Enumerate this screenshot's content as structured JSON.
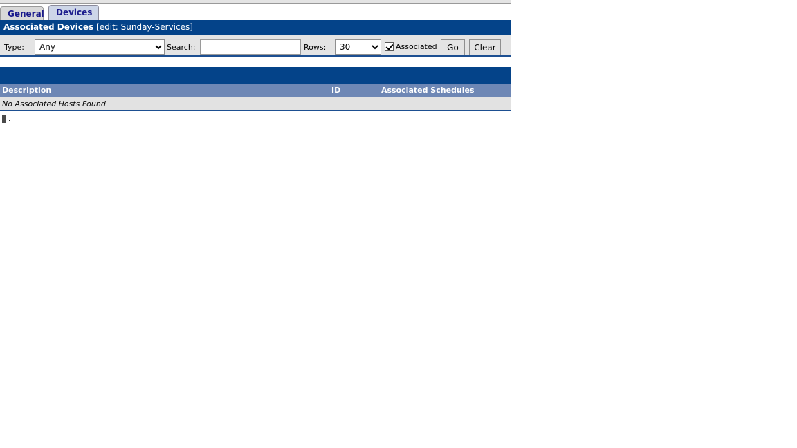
{
  "tabs": [
    {
      "label": "General",
      "active": false
    },
    {
      "label": "Devices",
      "active": true
    }
  ],
  "section": {
    "title": "Associated Devices",
    "subtitle": "[edit: Sunday-Services]"
  },
  "toolbar": {
    "type_label": "Type:",
    "type_value": "Any",
    "type_options": [
      "Any"
    ],
    "search_label": "Search:",
    "search_value": "",
    "search_placeholder": "",
    "rows_label": "Rows:",
    "rows_value": "30",
    "rows_options": [
      "30"
    ],
    "associated_label": "Associated",
    "associated_checked": true,
    "go_label": "Go",
    "clear_label": "Clear"
  },
  "table": {
    "columns": [
      "Description",
      "ID",
      "Associated Schedules"
    ],
    "rows": [],
    "empty_message": "No Associated Hosts Found"
  },
  "footer": {
    "dot": "."
  },
  "colors": {
    "header_blue": "#044389",
    "table_header_blue": "#6e87b5",
    "tab_text": "#1a1a8c",
    "toolbar_bg": "#e4e4e4",
    "empty_row_bg": "#e2e2e2"
  }
}
